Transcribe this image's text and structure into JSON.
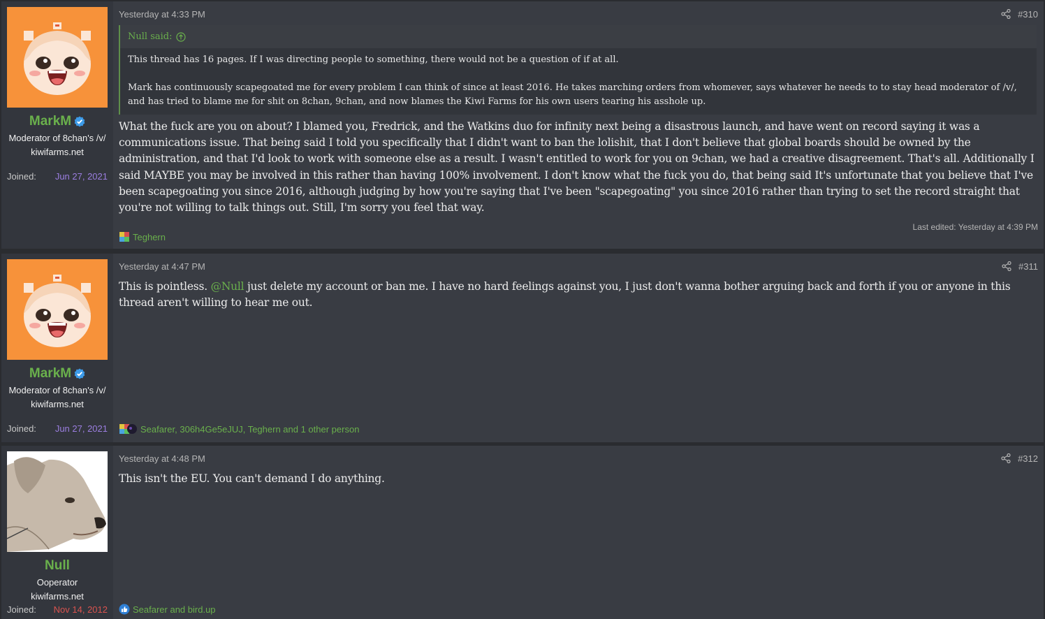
{
  "posts": [
    {
      "user": {
        "name": "MarkM",
        "title": "Moderator of 8chan's /v/",
        "site": "kiwifarms.net",
        "joined_label": "Joined:",
        "joined_date": "Jun 27, 2021",
        "avatar_icon": "anime-girl-avatar-icon",
        "verified_icon": "verified-badge-icon"
      },
      "timestamp": "Yesterday at 4:33 PM",
      "number": "#310",
      "quote": {
        "author": "Null said:",
        "p1": "This thread has 16 pages. If I was directing people to something, there would not be a question of if at all.",
        "p2": "Mark has continuously scapegoated me for every problem I can think of since at least 2016. He takes marching orders from whomever, says whatever he needs to to stay head moderator of /v/, and has tried to blame me for shit on 8chan, 9chan, and now blames the Kiwi Farms for his own users tearing his asshole up."
      },
      "body": "What the fuck are you on about? I blamed you, Fredrick, and the Watkins duo for infinity next being a disastrous launch, and have went on record saying it was a communications issue. That being said I told you specifically that I didn't want to ban the lolishit, that I don't believe that global boards should be owned by the administration, and that I'd look to work with someone else as a result. I wasn't entitled to work for you on 9chan, we had a creative disagreement. That's all. Additionally I said MAYBE you may be involved in this rather than having 100% involvement. I don't know what the fuck you do, that being said It's unfortunate that you believe that I've been scapegoating you since 2016, although judging by how you're saying that I've been \"scapegoating\" you since 2016 rather than trying to set the record straight that you're not willing to talk things out. Still, I'm sorry you feel that way.",
      "edited": "Last edited: Yesterday at 4:39 PM",
      "reactions": "Teghern"
    },
    {
      "user": {
        "name": "MarkM",
        "title": "Moderator of 8chan's /v/",
        "site": "kiwifarms.net",
        "joined_label": "Joined:",
        "joined_date": "Jun 27, 2021"
      },
      "timestamp": "Yesterday at 4:47 PM",
      "number": "#311",
      "body_pre": "This is pointless. ",
      "mention": "@Null",
      "body_post": " just delete my account or ban me. I have no hard feelings against you, I just don't wanna bother arguing back and forth if you or anyone in this thread aren't willing to hear me out.",
      "reactions": "Seafarer, 306h4Ge5eJUJ, Teghern and 1 other person"
    },
    {
      "user": {
        "name": "Null",
        "title": "Ooperator",
        "site": "kiwifarms.net",
        "joined_label": "Joined:",
        "joined_date": "Nov 14, 2012",
        "avatar_icon": "dog-avatar-icon"
      },
      "timestamp": "Yesterday at 4:48 PM",
      "number": "#312",
      "body": "This isn't the EU. You can't demand I do anything.",
      "reactions": "Seafarer and bird.up"
    }
  ],
  "colors": {
    "background": "#2a2c30",
    "post_bg": "#393c43",
    "username": "#6ab04c",
    "link": "#6ab04c",
    "joined_purple": "#9b7ee0",
    "joined_red": "#d9534f"
  }
}
